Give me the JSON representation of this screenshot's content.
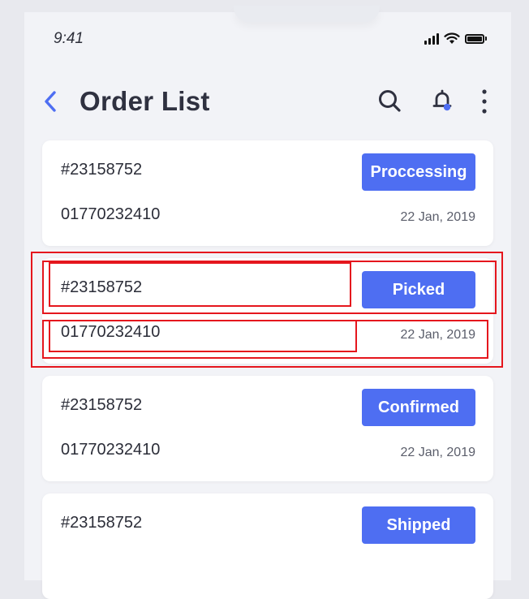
{
  "status_bar": {
    "time": "9:41"
  },
  "header": {
    "title": "Order List"
  },
  "orders": [
    {
      "id": "#23158752",
      "phone": "01770232410",
      "status": "Proccessing",
      "date": "22 Jan, 2019"
    },
    {
      "id": "#23158752",
      "phone": "01770232410",
      "status": "Picked",
      "date": "22 Jan, 2019"
    },
    {
      "id": "#23158752",
      "phone": "01770232410",
      "status": "Confirmed",
      "date": "22 Jan, 2019"
    },
    {
      "id": "#23158752",
      "phone": "",
      "status": "Shipped",
      "date": ""
    }
  ],
  "colors": {
    "accent": "#4e6ef2",
    "background": "#f2f3f7",
    "highlight": "#e5161d"
  },
  "icons": {
    "back": "chevron-left-icon",
    "search": "search-icon",
    "notifications": "bell-icon",
    "more": "more-vertical-icon"
  }
}
